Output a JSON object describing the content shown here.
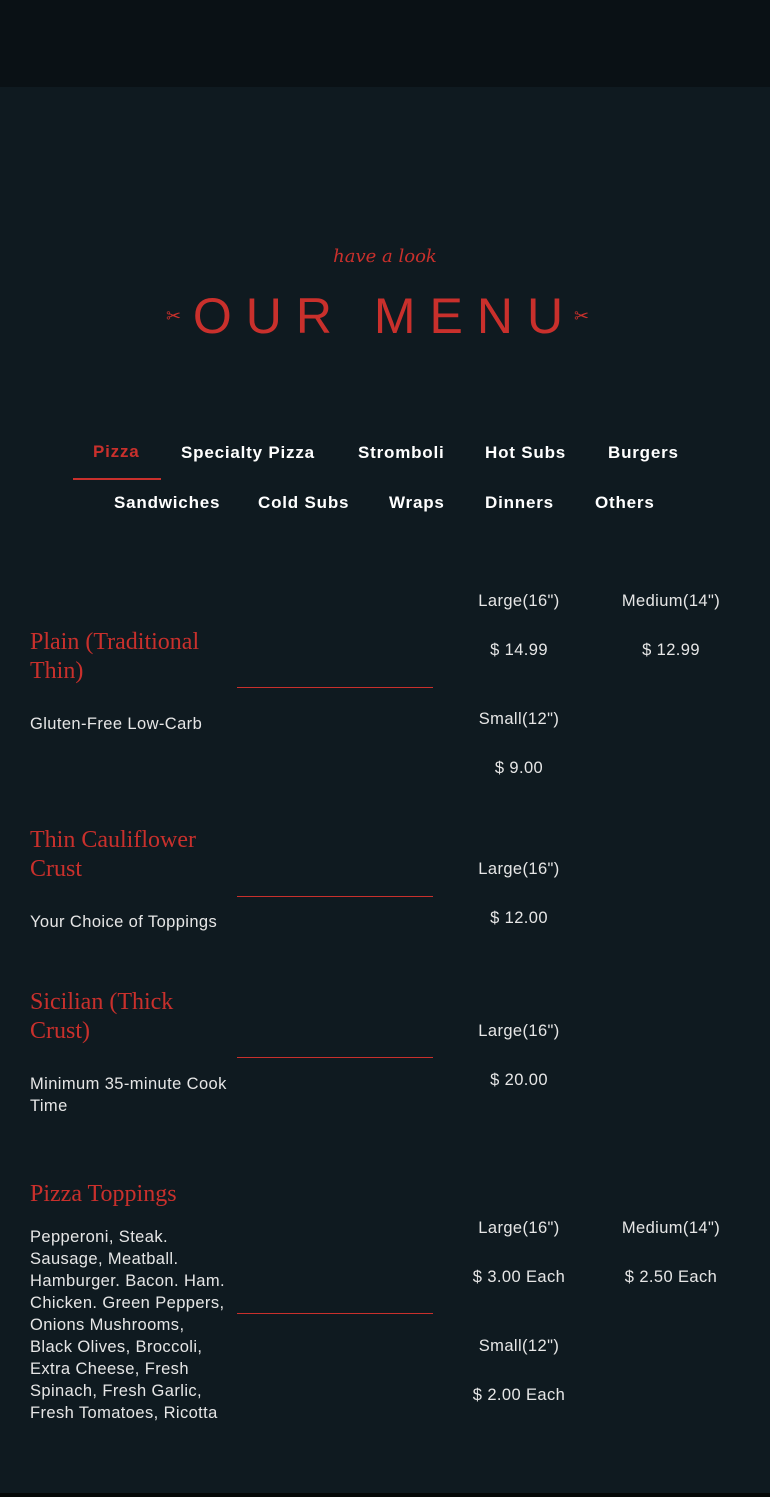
{
  "header": {
    "kicker": "have a look",
    "title": "OUR MENU",
    "ornament_left": "✂",
    "ornament_right": "✂"
  },
  "tabs": [
    {
      "label": "Pizza",
      "active": true
    },
    {
      "label": "Specialty Pizza",
      "active": false
    },
    {
      "label": "Stromboli",
      "active": false
    },
    {
      "label": "Hot Subs",
      "active": false
    },
    {
      "label": "Burgers",
      "active": false
    },
    {
      "label": "Sandwiches",
      "active": false
    },
    {
      "label": "Cold Subs",
      "active": false
    },
    {
      "label": "Wraps",
      "active": false
    },
    {
      "label": "Dinners",
      "active": false
    },
    {
      "label": "Others",
      "active": false
    }
  ],
  "items": [
    {
      "name": "Plain (Traditional Thin)",
      "description": "Gluten-Free Low-Carb",
      "prices": [
        {
          "size": "Large(16\")",
          "price": "$ 14.99"
        },
        {
          "size": "Medium(14\")",
          "price": "$ 12.99"
        },
        {
          "size": "Small(12\")",
          "price": "$ 9.00"
        }
      ]
    },
    {
      "name": "Thin Cauliflower Crust",
      "description": "Your Choice of Toppings",
      "prices": [
        {
          "size": "Large(16\")",
          "price": "$ 12.00"
        }
      ]
    },
    {
      "name": "Sicilian (Thick Crust)",
      "description": "Minimum 35-minute Cook Time",
      "prices": [
        {
          "size": "Large(16\")",
          "price": "$ 20.00"
        }
      ]
    },
    {
      "name": "Pizza Toppings",
      "description": "Pepperoni, Steak. Sausage, Meatball. Hamburger. Bacon. Ham. Chicken. Green Peppers, Onions Mushrooms, Black Olives, Broccoli, Extra Cheese, Fresh Spinach, Fresh Garlic, Fresh Tomatoes, Ricotta",
      "prices": [
        {
          "size": "Large(16\")",
          "price": "$ 3.00 Each"
        },
        {
          "size": "Medium(14\")",
          "price": "$ 2.50 Each"
        },
        {
          "size": "Small(12\")",
          "price": "$ 2.00 Each"
        }
      ]
    }
  ],
  "colors": {
    "accent": "#c9302c",
    "background": "#0f1a20",
    "topbar": "#0a1115",
    "text": "#e6e6e6"
  }
}
